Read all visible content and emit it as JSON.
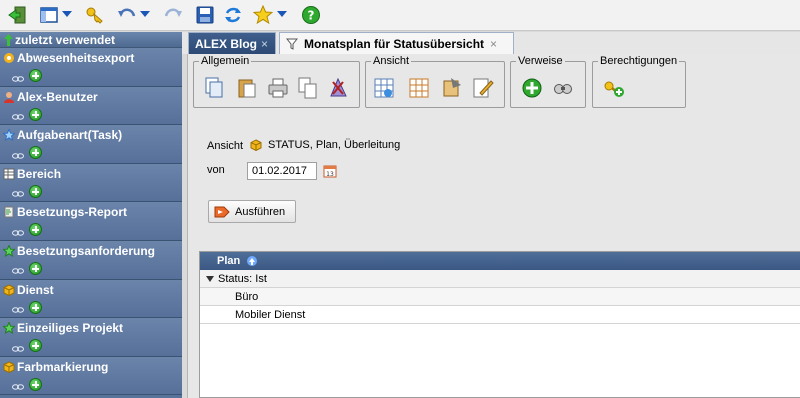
{
  "toolbar": {
    "buttons": [
      "logout-icon",
      "layout-icon",
      "key-icon",
      "undo-icon",
      "redo-icon",
      "save-icon",
      "refresh-icon",
      "star-icon",
      "help-icon"
    ]
  },
  "sidebar": {
    "header": "zuletzt verwendet",
    "items": [
      {
        "label": "Abwesenheitsexport",
        "icon": "export-icon"
      },
      {
        "label": "Alex-Benutzer",
        "icon": "user-icon"
      },
      {
        "label": "Aufgabenart(Task)",
        "icon": "star-outline-icon"
      },
      {
        "label": "Bereich",
        "icon": "table-icon"
      },
      {
        "label": "Besetzungs-Report",
        "icon": "report-icon"
      },
      {
        "label": "Besetzungsanforderung",
        "icon": "star-green-icon"
      },
      {
        "label": "Dienst",
        "icon": "box-icon"
      },
      {
        "label": "Einzeiliges Projekt",
        "icon": "star-green-icon"
      },
      {
        "label": "Farbmarkierung",
        "icon": "box-icon"
      }
    ]
  },
  "tabs": [
    {
      "label": "ALEX Blog",
      "close": "×"
    },
    {
      "label": "Monatsplan für Statusübersicht",
      "close": "×"
    }
  ],
  "groups": {
    "allgemein": "Allgemein",
    "ansicht": "Ansicht",
    "verweise": "Verweise",
    "berechtigungen": "Berechtigungen"
  },
  "form": {
    "ansicht_label": "Ansicht",
    "ansicht_value": "STATUS, Plan, Überleitung",
    "von_label": "von",
    "von_value": "01.02.2017",
    "run_label": "Ausführen"
  },
  "grid": {
    "column": "Plan",
    "group_label": "Status: Ist",
    "rows": [
      "Büro",
      "Mobiler Dienst"
    ]
  }
}
